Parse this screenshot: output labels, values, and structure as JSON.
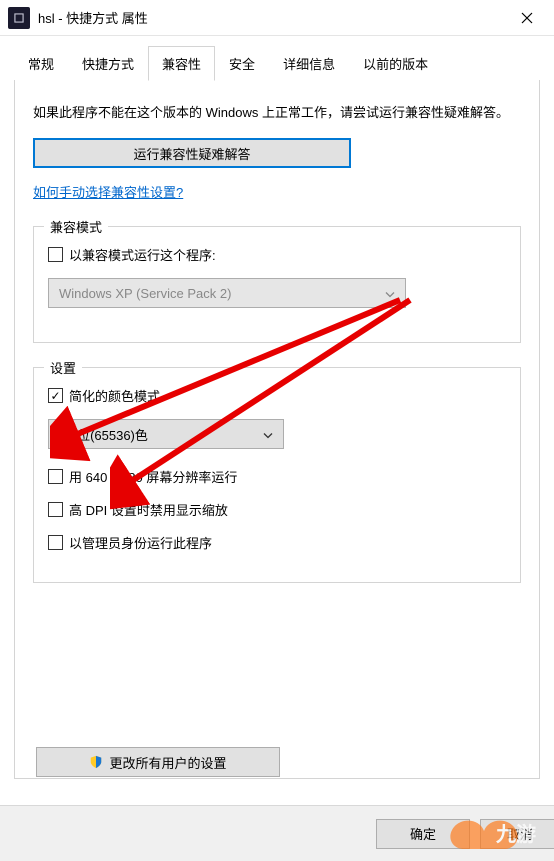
{
  "titlebar": {
    "title": "hsl - 快捷方式 属性"
  },
  "tabs": {
    "items": [
      {
        "label": "常规"
      },
      {
        "label": "快捷方式"
      },
      {
        "label": "兼容性"
      },
      {
        "label": "安全"
      },
      {
        "label": "详细信息"
      },
      {
        "label": "以前的版本"
      }
    ],
    "active_index": 2
  },
  "intro": "如果此程序不能在这个版本的 Windows 上正常工作，请尝试运行兼容性疑难解答。",
  "troubleshoot_btn": "运行兼容性疑难解答",
  "help_link": "如何手动选择兼容性设置?",
  "compat_mode": {
    "legend": "兼容模式",
    "checkbox_label": "以兼容模式运行这个程序:",
    "checked": false,
    "select_value": "Windows XP (Service Pack 2)"
  },
  "settings": {
    "legend": "设置",
    "reduced_color": {
      "label": "简化的颜色模式",
      "checked": true
    },
    "color_select": "16 位(65536)色",
    "res_640": {
      "label": "用 640 x 480 屏幕分辨率运行",
      "checked": false
    },
    "dpi": {
      "label": "高 DPI 设置时禁用显示缩放",
      "checked": false
    },
    "admin": {
      "label": "以管理员身份运行此程序",
      "checked": false
    }
  },
  "change_all_btn": "更改所有用户的设置",
  "footer": {
    "ok": "确定",
    "cancel": "取消"
  },
  "watermark": "九游"
}
